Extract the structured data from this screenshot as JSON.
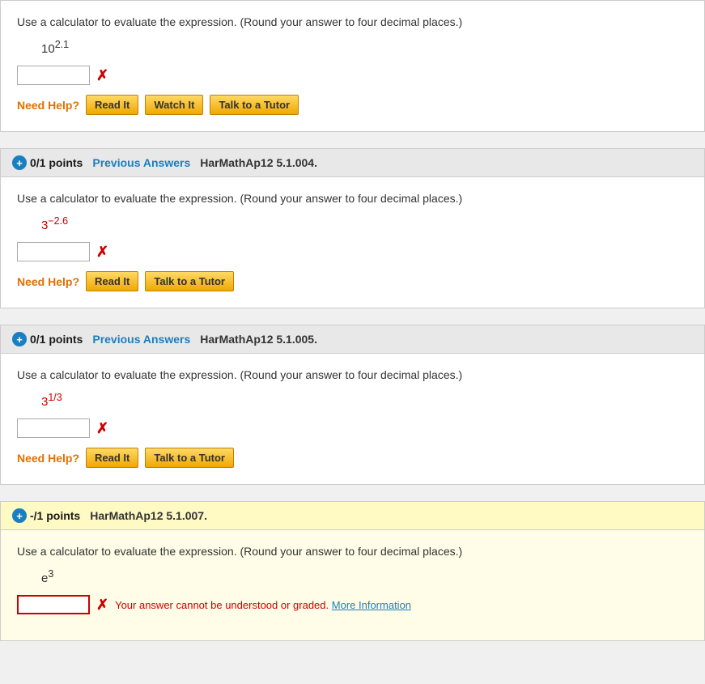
{
  "questions": [
    {
      "id": "q1",
      "hasHeader": false,
      "points": null,
      "hasPrevAnswers": false,
      "problemId": null,
      "questionText": "Use a calculator to evaluate the expression. (Round your answer to four decimal places.)",
      "mathBase": "10",
      "mathExp": "2.1",
      "answerValue": "",
      "hasError": false,
      "errorMsg": "",
      "needHelp": "Need Help?",
      "buttons": [
        {
          "label": "Read It",
          "name": "read-it-btn-1"
        },
        {
          "label": "Watch It",
          "name": "watch-it-btn-1"
        },
        {
          "label": "Talk to a Tutor",
          "name": "talk-tutor-btn-1"
        }
      ]
    },
    {
      "id": "q2",
      "hasHeader": true,
      "points": "0/1 points",
      "hasPrevAnswers": true,
      "prevAnswersLabel": "Previous Answers",
      "problemId": "HarMathAp12 5.1.004.",
      "questionText": "Use a calculator to evaluate the expression. (Round your answer to four decimal places.)",
      "mathBase": "3",
      "mathExp": "−2.6",
      "answerValue": "",
      "hasError": false,
      "errorMsg": "",
      "needHelp": "Need Help?",
      "buttons": [
        {
          "label": "Read It",
          "name": "read-it-btn-2"
        },
        {
          "label": "Talk to a Tutor",
          "name": "talk-tutor-btn-2"
        }
      ]
    },
    {
      "id": "q3",
      "hasHeader": true,
      "points": "0/1 points",
      "hasPrevAnswers": true,
      "prevAnswersLabel": "Previous Answers",
      "problemId": "HarMathAp12 5.1.005.",
      "questionText": "Use a calculator to evaluate the expression. (Round your answer to four decimal places.)",
      "mathBase": "3",
      "mathExp": "1/3",
      "answerValue": "",
      "hasError": false,
      "errorMsg": "",
      "needHelp": "Need Help?",
      "buttons": [
        {
          "label": "Read It",
          "name": "read-it-btn-3"
        },
        {
          "label": "Talk to a Tutor",
          "name": "talk-tutor-btn-3"
        }
      ]
    },
    {
      "id": "q4",
      "hasHeader": true,
      "isLast": true,
      "points": "-/1 points",
      "hasPrevAnswers": false,
      "problemId": "HarMathAp12 5.1.007.",
      "questionText": "Use a calculator to evaluate the expression. (Round your answer to four decimal places.)",
      "mathBase": "e",
      "mathExp": "3",
      "answerValue": "",
      "hasError": true,
      "errorMsg": "Your answer cannot be understood or graded.",
      "errorLink": "More Information",
      "needHelp": "Need Help?",
      "buttons": []
    }
  ],
  "labels": {
    "needHelp": "Need Help?",
    "readIt": "Read It",
    "watchIt": "Watch It",
    "talkTutor": "Talk to a Tutor"
  }
}
